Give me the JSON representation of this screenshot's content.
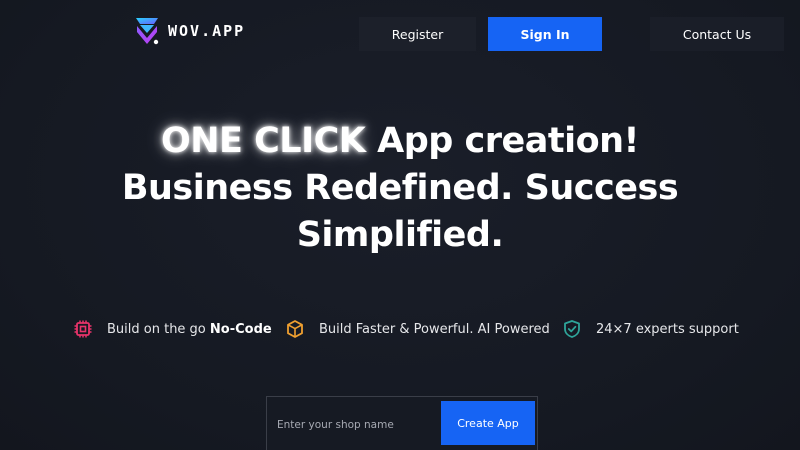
{
  "header": {
    "logo_text": "WOV.APP",
    "register_label": "Register",
    "signin_label": "Sign In",
    "contact_label": "Contact Us"
  },
  "hero": {
    "highlight": "ONE CLICK",
    "line1_rest": " App creation!",
    "line2": "Business Redefined. Success",
    "line3": "Simplified."
  },
  "features": [
    {
      "icon": "chip-icon",
      "text": "Build on the go ",
      "bold": "No-Code",
      "color": "#e8336a"
    },
    {
      "icon": "box-icon",
      "text": "Build Faster & Powerful. AI Powered",
      "color": "#f0a030"
    },
    {
      "icon": "shield-check-icon",
      "text": "24×7 experts support",
      "color": "#2ea59a"
    }
  ],
  "shop_form": {
    "placeholder": "Enter your shop name",
    "value": "",
    "button_label": "Create App"
  },
  "colors": {
    "accent": "#1664f4",
    "background": "#161a24"
  }
}
